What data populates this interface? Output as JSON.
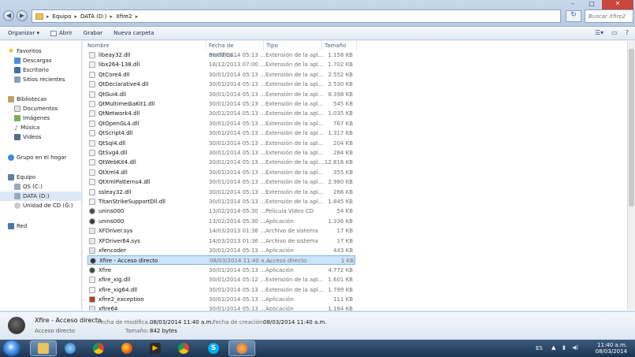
{
  "address": {
    "segments": [
      "Equipo",
      "DATA (D:)",
      "Xfire2"
    ],
    "search_placeholder": "Buscar Xfire2"
  },
  "window_controls": {
    "minimize": "–",
    "maximize": "□",
    "close": "✕"
  },
  "toolbar": {
    "organize": "Organizar ▾",
    "open": "Abrir",
    "record": "Grabar",
    "new_folder": "Nueva carpeta"
  },
  "sidebar": {
    "favorites": "Favoritos",
    "favorites_items": [
      "Descargas",
      "Escritorio",
      "Sitios recientes"
    ],
    "libraries": "Bibliotecas",
    "libraries_items": [
      "Documentos",
      "Imágenes",
      "Música",
      "Vídeos"
    ],
    "homegroup": "Grupo en el hogar",
    "computer": "Equipo",
    "computer_items": [
      "OS (C:)",
      "DATA (D:)",
      "Unidad de CD (G:)"
    ],
    "network": "Red"
  },
  "columns": {
    "name": "Nombre",
    "date": "Fecha de modifica...",
    "type": "Tipo",
    "size": "Tamaño"
  },
  "files": [
    {
      "name": "libeay32.dll",
      "date": "30/01/2014 05:13 ...",
      "type": "Extensión de la apl...",
      "size": "1.158 KB",
      "icon": "dll-icon"
    },
    {
      "name": "libx264-138.dll",
      "date": "18/12/2013 07:00 ...",
      "type": "Extensión de la apl...",
      "size": "1.702 KB",
      "icon": "dll-icon"
    },
    {
      "name": "QtCore4.dll",
      "date": "30/01/2014 05:13 ...",
      "type": "Extensión de la apl...",
      "size": "2.552 KB",
      "icon": "dll-icon"
    },
    {
      "name": "QtDeclarative4.dll",
      "date": "30/01/2014 05:13 ...",
      "type": "Extensión de la apl...",
      "size": "2.530 KB",
      "icon": "dll-icon"
    },
    {
      "name": "QtGui4.dll",
      "date": "30/01/2014 05:13 ...",
      "type": "Extensión de la apl...",
      "size": "8.398 KB",
      "icon": "dll-icon"
    },
    {
      "name": "QtMultimediaKit1.dll",
      "date": "30/01/2014 05:13 ...",
      "type": "Extensión de la apl...",
      "size": "545 KB",
      "icon": "dll-icon"
    },
    {
      "name": "QtNetwork4.dll",
      "date": "30/01/2014 05:13 ...",
      "type": "Extensión de la apl...",
      "size": "1.035 KB",
      "icon": "dll-icon"
    },
    {
      "name": "QtOpenGL4.dll",
      "date": "30/01/2014 05:13 ...",
      "type": "Extensión de la apl...",
      "size": "767 KB",
      "icon": "dll-icon"
    },
    {
      "name": "QtScript4.dll",
      "date": "30/01/2014 05:13 ...",
      "type": "Extensión de la apl...",
      "size": "1.317 KB",
      "icon": "dll-icon"
    },
    {
      "name": "QtSql4.dll",
      "date": "30/01/2014 05:13 ...",
      "type": "Extensión de la apl...",
      "size": "204 KB",
      "icon": "dll-icon"
    },
    {
      "name": "QtSvg4.dll",
      "date": "30/01/2014 05:13 ...",
      "type": "Extensión de la apl...",
      "size": "284 KB",
      "icon": "dll-icon"
    },
    {
      "name": "QtWebKit4.dll",
      "date": "30/01/2014 05:13 ...",
      "type": "Extensión de la apl...",
      "size": "12.816 KB",
      "icon": "dll-icon"
    },
    {
      "name": "QtXml4.dll",
      "date": "30/01/2014 05:13 ...",
      "type": "Extensión de la apl...",
      "size": "355 KB",
      "icon": "dll-icon"
    },
    {
      "name": "QtXmlPatterns4.dll",
      "date": "30/01/2014 05:13 ...",
      "type": "Extensión de la apl...",
      "size": "2.980 KB",
      "icon": "dll-icon"
    },
    {
      "name": "ssleay32.dll",
      "date": "30/01/2014 05:13 ...",
      "type": "Extensión de la apl...",
      "size": "266 KB",
      "icon": "dll-icon"
    },
    {
      "name": "TitanStrikeSupportDll.dll",
      "date": "30/01/2014 05:13 ...",
      "type": "Extensión de la apl...",
      "size": "1.845 KB",
      "icon": "dll-icon"
    },
    {
      "name": "unins000",
      "date": "13/02/2014 05:30 ...",
      "type": "Película Video CD",
      "size": "54 KB",
      "icon": "video-cd-icon"
    },
    {
      "name": "unins000",
      "date": "13/02/2014 05:30 ...",
      "type": "Aplicación",
      "size": "1.336 KB",
      "icon": "uninstaller-icon"
    },
    {
      "name": "XFDriver.sys",
      "date": "14/03/2013 01:36 ...",
      "type": "Archivo de sistema",
      "size": "17 KB",
      "icon": "system-file-icon"
    },
    {
      "name": "XFDriver64.sys",
      "date": "14/03/2013 01:36 ...",
      "type": "Archivo de sistema",
      "size": "17 KB",
      "icon": "system-file-icon"
    },
    {
      "name": "xfencoder",
      "date": "30/01/2014 05:13 ...",
      "type": "Aplicación",
      "size": "443 KB",
      "icon": "application-icon"
    },
    {
      "name": "Xfire - Acceso directo",
      "date": "08/03/2014 11:40 a....",
      "type": "Acceso directo",
      "size": "1 KB",
      "icon": "xfire-shortcut-icon",
      "selected": true
    },
    {
      "name": "Xfire",
      "date": "30/01/2014 05:13 ...",
      "type": "Aplicación",
      "size": "4.772 KB",
      "icon": "xfire-icon"
    },
    {
      "name": "xfire_xig.dll",
      "date": "30/01/2014 05:12 ...",
      "type": "Extensión de la apl...",
      "size": "1.601 KB",
      "icon": "dll-icon"
    },
    {
      "name": "xfire_xig64.dll",
      "date": "30/01/2014 05:13 ...",
      "type": "Extensión de la apl...",
      "size": "1.799 KB",
      "icon": "dll-icon"
    },
    {
      "name": "xfire2_exception",
      "date": "30/01/2014 05:13 ...",
      "type": "Aplicación",
      "size": "111 KB",
      "icon": "exception-app-icon"
    },
    {
      "name": "xfire64",
      "date": "30/01/2014 05:13 ...",
      "type": "Aplicación",
      "size": "1.184 KB",
      "icon": "application-icon"
    }
  ],
  "details": {
    "name": "Xfire - Acceso directo",
    "kind": "Acceso directo",
    "mod_label": "Fecha de modifica...",
    "mod_value": "08/03/2014 11:40 a.m.",
    "size_label": "Tamaño:",
    "size_value": "842 bytes",
    "created_label": "Fecha de creación:",
    "created_value": "08/03/2014 11:40 a.m."
  },
  "taskbar": {
    "lang": "ES",
    "time": "11:40 a.m.",
    "date": "08/03/2014",
    "apps": [
      "explorer-icon",
      "internet-explorer-icon",
      "chrome-icon",
      "firefox-icon",
      "media-player-icon",
      "chrome-icon",
      "skype-icon",
      "xfire-icon"
    ]
  },
  "colors": {
    "selection": "#cce4fa",
    "selection_border": "#7eb4ea",
    "taskbar": "#1d3554"
  }
}
